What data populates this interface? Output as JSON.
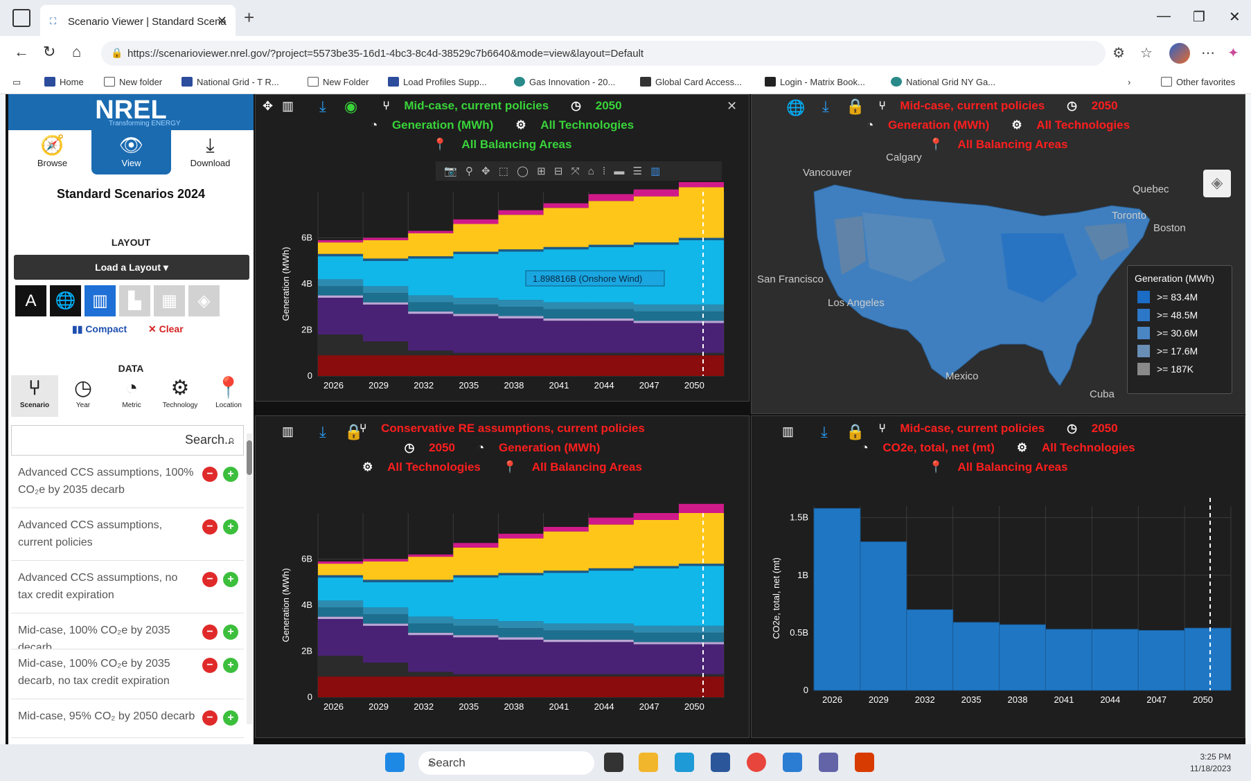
{
  "browser": {
    "tab_title": "Scenario Viewer | Standard Scena",
    "url": "https://scenarioviewer.nrel.gov/?project=5573be35-16d1-4bc3-8c4d-38529c7b6640&mode=view&layout=Default",
    "bookmarks": [
      "Home",
      "New folder",
      "National Grid - T R...",
      "New Folder",
      "Load Profiles Supp...",
      "Gas Innovation - 20...",
      "Global Card Access...",
      "Login - Matrix Book...",
      "National Grid NY Ga..."
    ],
    "other_favorites": "Other favorites"
  },
  "sidebar": {
    "brand": "NREL",
    "brand_sub": "Transforming ENERGY",
    "tabs": [
      "Browse",
      "View",
      "Download"
    ],
    "title": "Standard Scenarios 2024",
    "layout_label": "LAYOUT",
    "load_layout": "Load a Layout ▾",
    "layout_a": "A",
    "compact": "Compact",
    "clear": "Clear",
    "data_label": "DATA",
    "data_tabs": [
      "Scenario",
      "Year",
      "Metric",
      "Technology",
      "Location"
    ],
    "search_placeholder": "Search...",
    "scenarios": [
      "Advanced CCS assumptions, 100% CO₂e by 2035 decarb",
      "Advanced CCS assumptions, current policies",
      "Advanced CCS assumptions, no tax credit expiration",
      "Mid-case, 100% CO₂e by 2035 decarb",
      "Mid-case, 100% CO₂e by 2035 decarb, no tax credit expiration",
      "Mid-case, 95% CO₂ by 2050 decarb"
    ]
  },
  "panels": {
    "p1": {
      "scenario": "Mid-case, current policies",
      "year": "2050",
      "metric": "Generation (MWh)",
      "tech": "All Technologies",
      "area": "All Balancing Areas",
      "tooltip": "1.898816B  (Onshore Wind)"
    },
    "p2": {
      "scenario": "Mid-case, current policies",
      "year": "2050",
      "metric": "Generation (MWh)",
      "tech": "All Technologies",
      "area": "All Balancing Areas",
      "map_labels": [
        "Calgary",
        "Vancouver",
        "Quebec",
        "Toronto",
        "Boston",
        "San Francisco",
        "Los Angeles",
        "Mexico",
        "Cuba"
      ],
      "legend_title": "Generation (MWh)",
      "legend": [
        {
          "label": ">= 83.4M",
          "color": "#1a6cc4"
        },
        {
          "label": ">= 48.5M",
          "color": "#2d77c8"
        },
        {
          "label": ">= 30.6M",
          "color": "#4a86c4"
        },
        {
          "label": ">= 17.6M",
          "color": "#6a8fb6"
        },
        {
          "label": ">= 187K",
          "color": "#8a8a8a"
        }
      ]
    },
    "p3": {
      "scenario": "Conservative RE assumptions, current policies",
      "year": "2050",
      "metric": "Generation (MWh)",
      "tech": "All Technologies",
      "area": "All Balancing Areas"
    },
    "p4": {
      "scenario": "Mid-case, current policies",
      "year": "2050",
      "metric": "CO2e, total, net (mt)",
      "tech": "All Technologies",
      "area": "All Balancing Areas"
    }
  },
  "taskbar": {
    "search": "Search",
    "time": "3:25 PM",
    "date": "11/18/2023"
  },
  "chart_data": [
    {
      "type": "area",
      "title": "",
      "ylabel": "Generation (MWh)",
      "xlabel": "",
      "x": [
        "2026",
        "2029",
        "2032",
        "2035",
        "2038",
        "2041",
        "2044",
        "2047",
        "2050"
      ],
      "ylim": [
        0,
        8
      ],
      "yticks": [
        "0",
        "2B",
        "4B",
        "6B"
      ],
      "unit": "billions MWh",
      "series": [
        {
          "color": "#8b0c0c",
          "values": [
            0.9,
            0.9,
            0.9,
            0.9,
            0.9,
            0.9,
            0.9,
            0.9,
            0.9
          ]
        },
        {
          "color": "#2b2b2b",
          "values": [
            0.9,
            0.6,
            0.2,
            0.1,
            0.1,
            0.1,
            0.1,
            0.1,
            0.1
          ]
        },
        {
          "color": "#4a2275",
          "values": [
            1.6,
            1.6,
            1.6,
            1.6,
            1.5,
            1.4,
            1.4,
            1.3,
            1.3
          ]
        },
        {
          "color": "#b9a7d6",
          "values": [
            0.1,
            0.1,
            0.1,
            0.1,
            0.1,
            0.1,
            0.1,
            0.1,
            0.1
          ]
        },
        {
          "color": "#1d6f8f",
          "values": [
            0.4,
            0.4,
            0.4,
            0.4,
            0.4,
            0.4,
            0.4,
            0.4,
            0.4
          ]
        },
        {
          "color": "#2e8bb0",
          "values": [
            0.3,
            0.3,
            0.3,
            0.3,
            0.3,
            0.3,
            0.3,
            0.3,
            0.3
          ]
        },
        {
          "color": "#12b7ea",
          "values": [
            1.0,
            1.1,
            1.6,
            1.9,
            2.1,
            2.3,
            2.4,
            2.6,
            2.8
          ]
        },
        {
          "color": "#1a5b8a",
          "values": [
            0.1,
            0.1,
            0.1,
            0.1,
            0.1,
            0.1,
            0.1,
            0.1,
            0.1
          ]
        },
        {
          "color": "#ffc61a",
          "values": [
            0.5,
            0.8,
            1.0,
            1.2,
            1.5,
            1.7,
            1.9,
            2.0,
            2.2
          ]
        },
        {
          "color": "#d11a8a",
          "values": [
            0.1,
            0.1,
            0.1,
            0.2,
            0.2,
            0.2,
            0.3,
            0.3,
            0.4
          ]
        }
      ]
    },
    {
      "type": "area",
      "title": "",
      "ylabel": "Generation (MWh)",
      "xlabel": "",
      "x": [
        "2026",
        "2029",
        "2032",
        "2035",
        "2038",
        "2041",
        "2044",
        "2047",
        "2050"
      ],
      "ylim": [
        0,
        8
      ],
      "yticks": [
        "0",
        "2B",
        "4B",
        "6B"
      ],
      "unit": "billions MWh",
      "series": [
        {
          "color": "#8b0c0c",
          "values": [
            0.9,
            0.9,
            0.9,
            0.9,
            0.9,
            0.9,
            0.9,
            0.9,
            0.9
          ]
        },
        {
          "color": "#2b2b2b",
          "values": [
            0.9,
            0.6,
            0.2,
            0.1,
            0.1,
            0.1,
            0.1,
            0.1,
            0.1
          ]
        },
        {
          "color": "#4a2275",
          "values": [
            1.6,
            1.6,
            1.6,
            1.6,
            1.5,
            1.4,
            1.4,
            1.3,
            1.3
          ]
        },
        {
          "color": "#b9a7d6",
          "values": [
            0.1,
            0.1,
            0.1,
            0.1,
            0.1,
            0.1,
            0.1,
            0.1,
            0.1
          ]
        },
        {
          "color": "#1d6f8f",
          "values": [
            0.4,
            0.4,
            0.4,
            0.4,
            0.4,
            0.4,
            0.4,
            0.4,
            0.4
          ]
        },
        {
          "color": "#2e8bb0",
          "values": [
            0.3,
            0.3,
            0.3,
            0.3,
            0.3,
            0.3,
            0.3,
            0.3,
            0.3
          ]
        },
        {
          "color": "#12b7ea",
          "values": [
            1.0,
            1.1,
            1.5,
            1.8,
            2.0,
            2.2,
            2.3,
            2.5,
            2.6
          ]
        },
        {
          "color": "#1a5b8a",
          "values": [
            0.1,
            0.1,
            0.1,
            0.1,
            0.1,
            0.1,
            0.1,
            0.1,
            0.1
          ]
        },
        {
          "color": "#ffc61a",
          "values": [
            0.5,
            0.8,
            1.0,
            1.2,
            1.5,
            1.7,
            1.9,
            2.0,
            2.2
          ]
        },
        {
          "color": "#d11a8a",
          "values": [
            0.1,
            0.1,
            0.1,
            0.2,
            0.2,
            0.2,
            0.3,
            0.3,
            0.4
          ]
        }
      ]
    },
    {
      "type": "bar",
      "title": "",
      "ylabel": "CO2e, total, net (mt)",
      "xlabel": "",
      "categories": [
        "2026",
        "2029",
        "2032",
        "2035",
        "2038",
        "2041",
        "2044",
        "2047",
        "2050"
      ],
      "values": [
        1.58,
        1.29,
        0.7,
        0.59,
        0.57,
        0.53,
        0.53,
        0.52,
        0.54
      ],
      "ylim": [
        0,
        1.6
      ],
      "yticks": [
        "0",
        "0.5B",
        "1B",
        "1.5B"
      ],
      "color": "#1f77c4"
    }
  ]
}
